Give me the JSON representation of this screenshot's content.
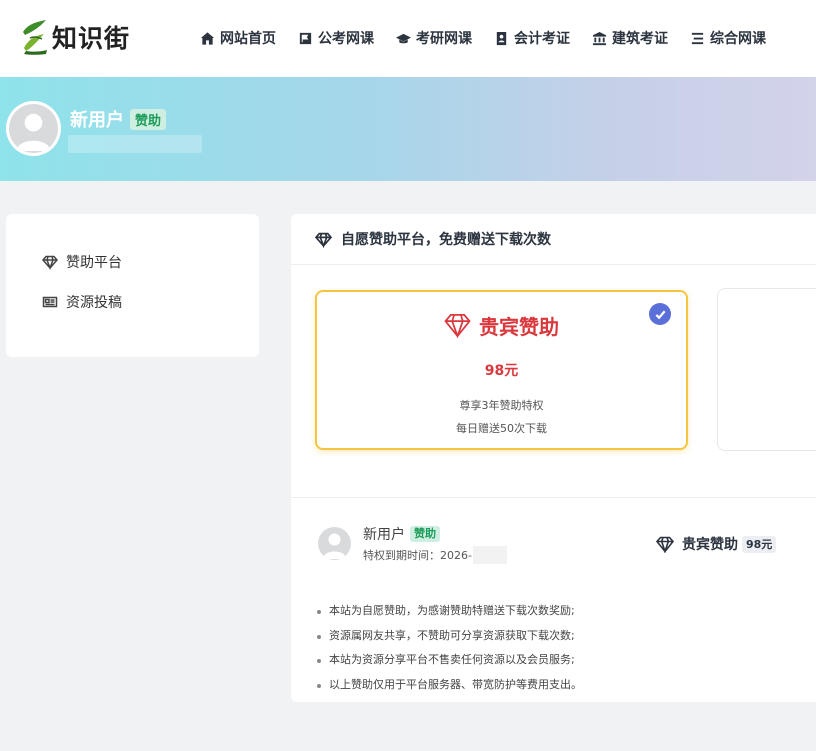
{
  "brand": {
    "name": "知识街"
  },
  "nav": [
    {
      "label": "网站首页",
      "icon": "home-icon"
    },
    {
      "label": "公考网课",
      "icon": "flag-icon"
    },
    {
      "label": "考研网课",
      "icon": "graduation-cap-icon"
    },
    {
      "label": "会计考证",
      "icon": "id-card-icon"
    },
    {
      "label": "建筑考证",
      "icon": "bank-icon"
    },
    {
      "label": "综合网课",
      "icon": "list-icon"
    }
  ],
  "profile": {
    "name": "新用户",
    "badge": "赞助"
  },
  "sidebar": {
    "items": [
      {
        "label": "赞助平台",
        "icon": "diamond-icon"
      },
      {
        "label": "资源投稿",
        "icon": "newspaper-icon"
      }
    ]
  },
  "main": {
    "title": "自愿赞助平台，免费赠送下载次数",
    "plan": {
      "title": "贵宾赞助",
      "price": "98元",
      "desc1": "尊享3年赞助特权",
      "desc2": "每日赠送50次下载",
      "selected": true,
      "accent": "#d9383d",
      "border": "#f5c542"
    },
    "user": {
      "name": "新用户",
      "badge": "赞助",
      "expire_label": "特权到期时间：",
      "expire_value": "2026-",
      "plan_name": "贵宾赞助",
      "plan_price": "98元"
    },
    "notes": [
      "本站为自愿赞助，为感谢赞助特赠送下载次数奖励;",
      "资源属网友共享，不赞助可分享资源获取下载次数;",
      "本站为资源分享平台不售卖任何资源以及会员服务;",
      "以上赞助仅用于平台服务器、带宽防护等费用支出。"
    ]
  }
}
